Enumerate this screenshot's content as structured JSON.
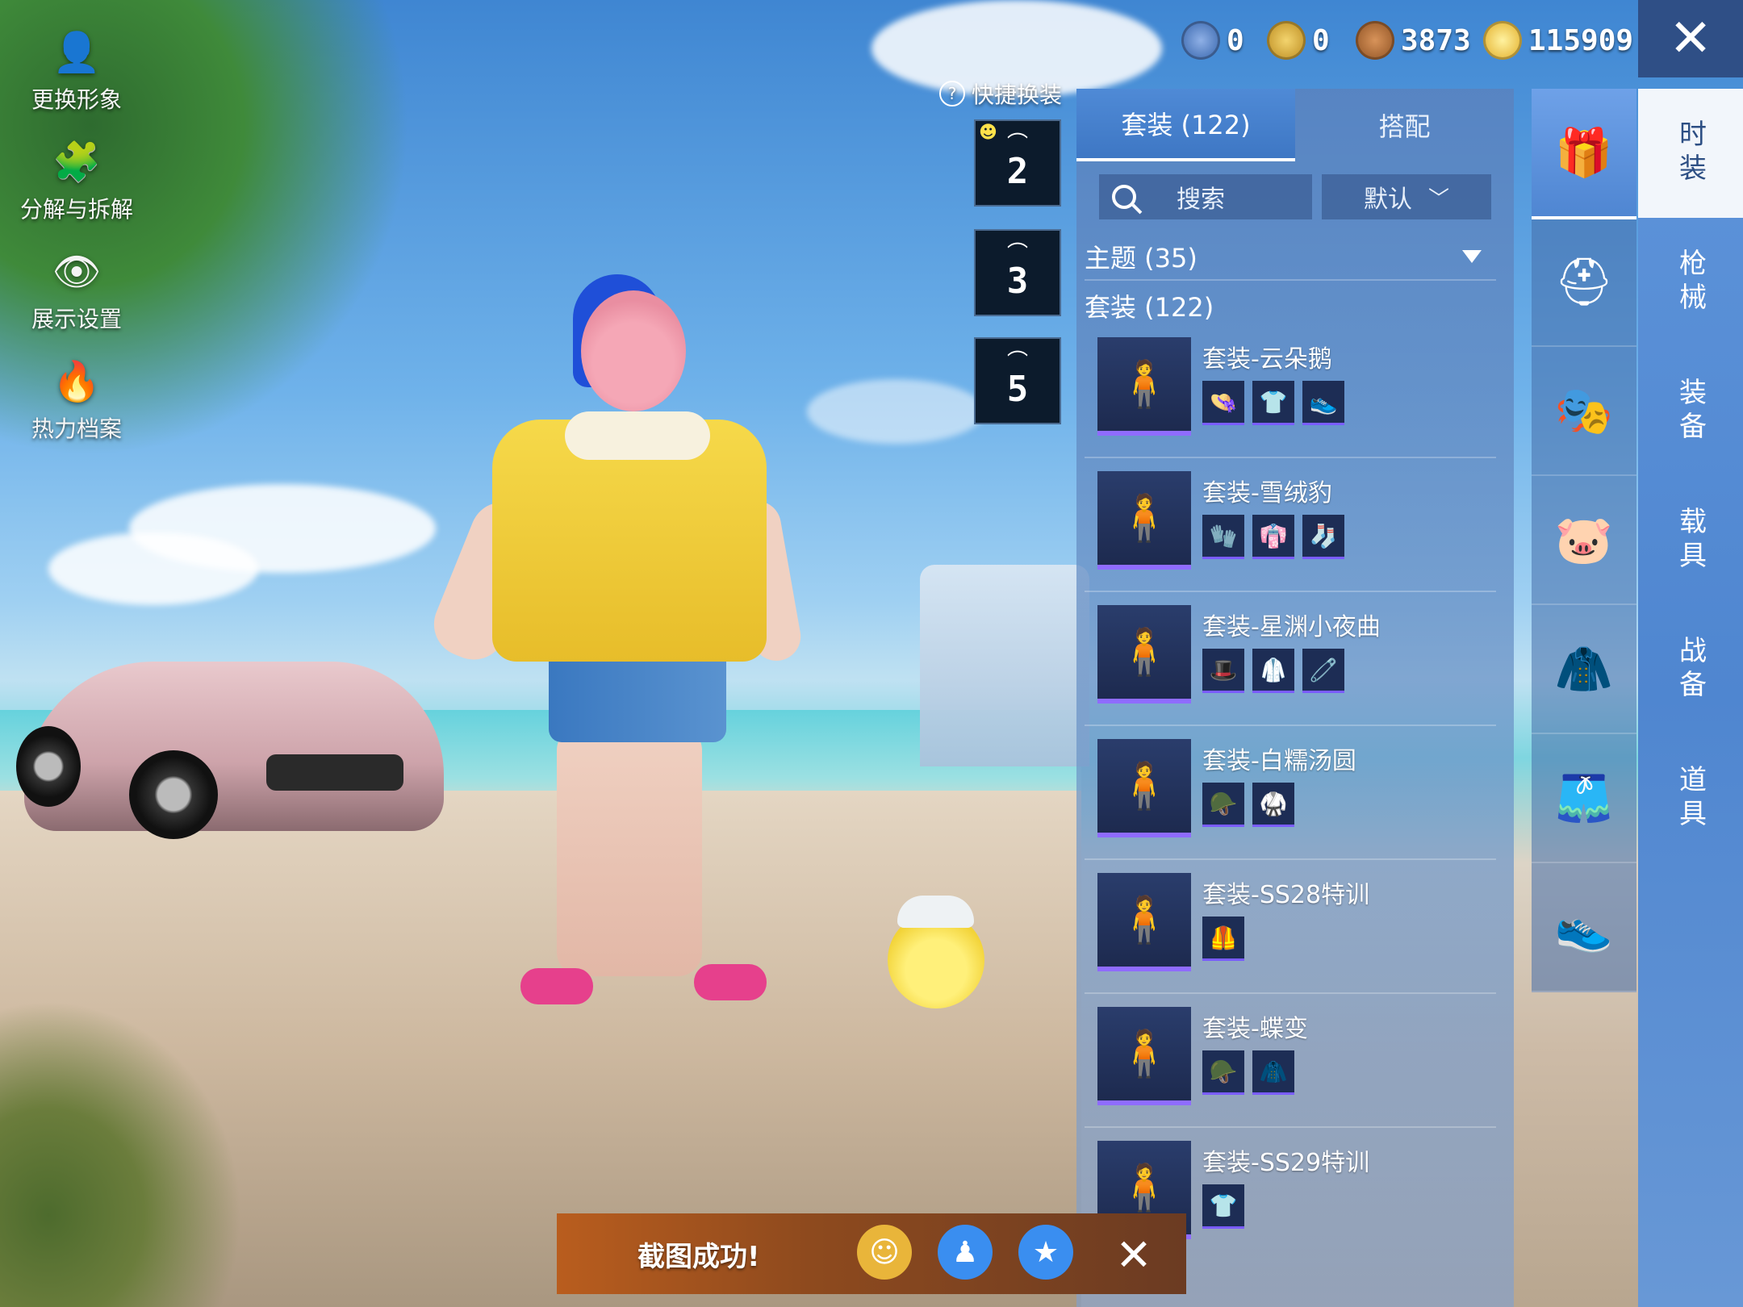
{
  "left_menu": [
    {
      "label": "更换形象",
      "icon": "avatar-icon"
    },
    {
      "label": "分解与拆解",
      "icon": "puzzle-icon"
    },
    {
      "label": "展示设置",
      "icon": "eye-icon"
    },
    {
      "label": "热力档案",
      "icon": "flame-icon"
    }
  ],
  "currencies": [
    {
      "icon": "silver-token-icon",
      "value": "0",
      "color": "#2f5fa8"
    },
    {
      "icon": "gold-emblem-icon",
      "value": "0",
      "color": "#d8a320"
    },
    {
      "icon": "bronze-coin-icon",
      "value": "3873",
      "color": "#a8642a"
    },
    {
      "icon": "lightning-coin-icon",
      "value": "115909",
      "color": "#f0c232"
    }
  ],
  "quick_swap": {
    "label": "快捷换装",
    "slots": [
      "2",
      "3",
      "5"
    ]
  },
  "panel": {
    "tabs": [
      "套装 (122)",
      "搭配"
    ],
    "search_placeholder": "搜索",
    "sort_label": "默认",
    "theme_label": "主题 (35)",
    "suit_header": "套装 (122)",
    "sets": [
      {
        "name": "套装-云朵鹅",
        "items": [
          "👒",
          "👕",
          "👟"
        ]
      },
      {
        "name": "套装-雪绒豹",
        "items": [
          "🧤",
          "👘",
          "🧦"
        ]
      },
      {
        "name": "套装-星渊小夜曲",
        "items": [
          "🎩",
          "🥼",
          "🧷"
        ]
      },
      {
        "name": "套装-白糯汤圆",
        "items": [
          "🪖",
          "🥋"
        ]
      },
      {
        "name": "套装-SS28特训",
        "items": [
          "🦺"
        ]
      },
      {
        "name": "套装-蝶变",
        "items": [
          "🪖",
          "🧥"
        ]
      },
      {
        "name": "套装-SS29特训",
        "items": [
          "👕"
        ]
      }
    ]
  },
  "categories": [
    {
      "icon": "wardrobe-box-icon"
    },
    {
      "icon": "helmet-icon"
    },
    {
      "icon": "mask-icon"
    },
    {
      "icon": "pig-face-icon"
    },
    {
      "icon": "jacket-icon"
    },
    {
      "icon": "shorts-icon"
    },
    {
      "icon": "shoes-icon"
    }
  ],
  "vertical_tabs": [
    "时装",
    "枪械",
    "装备",
    "载具",
    "战备",
    "道具"
  ],
  "toast": {
    "text": "截图成功!"
  }
}
